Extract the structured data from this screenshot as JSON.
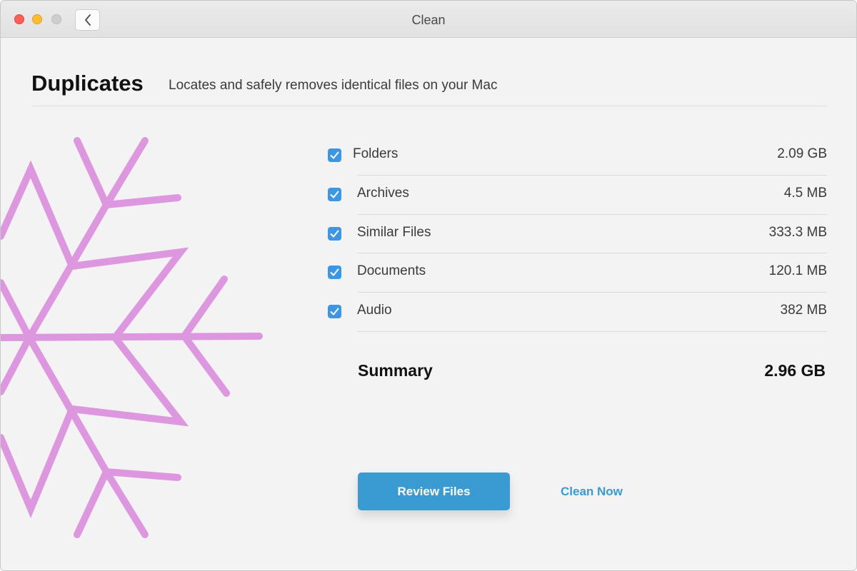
{
  "window": {
    "title": "Clean"
  },
  "header": {
    "title": "Duplicates",
    "subtitle": "Locates and safely removes identical files on your Mac"
  },
  "categories": [
    {
      "label": "Folders",
      "size": "2.09 GB",
      "checked": true
    },
    {
      "label": "Archives",
      "size": "4.5 MB",
      "checked": true
    },
    {
      "label": "Similar Files",
      "size": "333.3 MB",
      "checked": true
    },
    {
      "label": "Documents",
      "size": "120.1 MB",
      "checked": true
    },
    {
      "label": "Audio",
      "size": "382 MB",
      "checked": true
    }
  ],
  "summary": {
    "label": "Summary",
    "value": "2.96 GB"
  },
  "actions": {
    "review_label": "Review Files",
    "clean_label": "Clean Now"
  },
  "colors": {
    "accent": "#3a9bd3",
    "checkbox": "#3d96e4",
    "illustration": "#dd97df"
  },
  "icons": {
    "back": "chevron-left-icon",
    "checkbox": "checkmark-icon",
    "illustration": "snowflake-icon"
  }
}
